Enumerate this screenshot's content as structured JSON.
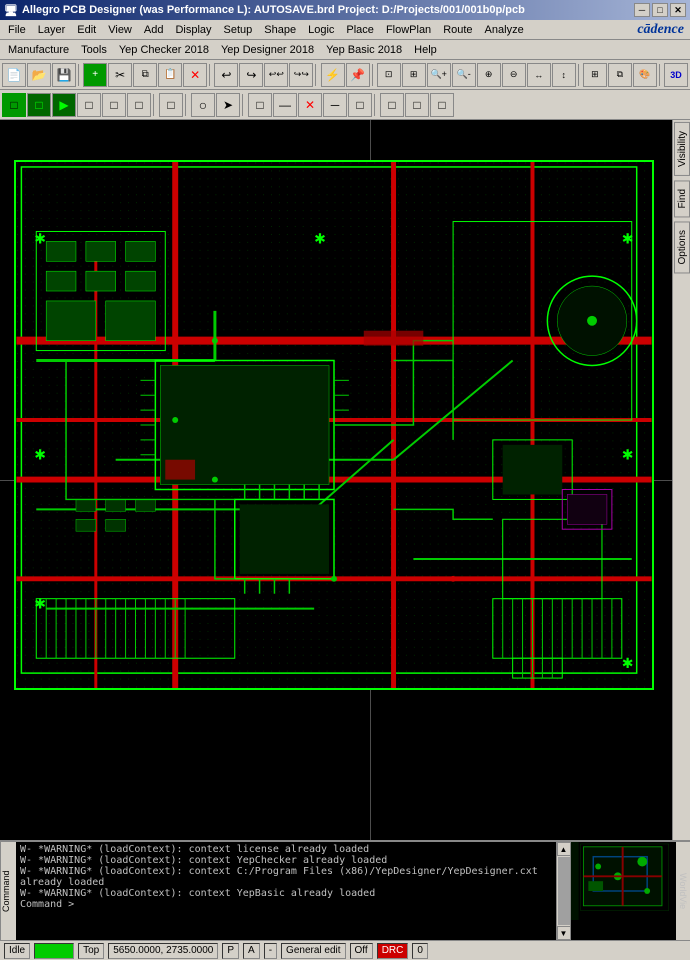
{
  "titleBar": {
    "icon": "📋",
    "title": "Allegro PCB Designer (was Performance L): AUTOSAVE.brd  Project: D:/Projects/001/001b0p/pcb",
    "minimize": "─",
    "maximize": "□",
    "close": "✕"
  },
  "menuBar1": {
    "items": [
      "File",
      "Layer",
      "Edit",
      "View",
      "Add",
      "Display",
      "Setup",
      "Shape",
      "Logic",
      "Place",
      "FlowPlan",
      "Route",
      "Analyze"
    ]
  },
  "menuBar2": {
    "items": [
      "Manufacture",
      "Tools",
      "Yep Checker 2018",
      "Yep Designer 2018",
      "Yep Basic 2018",
      "Help"
    ]
  },
  "toolbar1": {
    "buttons": [
      "📂",
      "💾",
      "🖨",
      "✂",
      "📋",
      "🔄",
      "↩",
      "↪",
      "⚡",
      "📌",
      "📊",
      "📋",
      "📋",
      "📋",
      "📋",
      "📋",
      "📋",
      "🔍",
      "🔍",
      "🔍",
      "🔍",
      "🔍",
      "🔍",
      "🔍",
      "🔍",
      "🔍",
      "📋",
      "📋",
      "📋",
      "3D"
    ]
  },
  "toolbar2": {
    "buttons": [
      "□",
      "□",
      "▶",
      "□",
      "□",
      "□",
      "□",
      "□",
      "○",
      "➤",
      "□",
      "□",
      "□",
      "📋",
      "✕",
      "—",
      "□",
      "□",
      "□"
    ]
  },
  "rightPanel": {
    "tabs": [
      "Visibility",
      "Find",
      "Options"
    ]
  },
  "console": {
    "lines": [
      "W- *WARNING* (loadContext): context license already loaded",
      "W- *WARNING* (loadContext): context YepChecker already loaded",
      "W- *WARNING* (loadContext): context C:/Program Files (x86)/YepDesigner/YepDesigner.cxt already loaded",
      "W- *WARNING* (loadContext): context YepBasic already loaded",
      "Command >"
    ]
  },
  "statusBar": {
    "state": "Idle",
    "indicator": "",
    "layer": "Top",
    "coordinates": "5650.0000, 2735.0000",
    "marker1": "P",
    "marker2": "A",
    "separator": "-",
    "mode": "General edit",
    "off_label": "Off",
    "drc_label": "DRC",
    "counter": "0"
  },
  "worldview": "WorldVie"
}
